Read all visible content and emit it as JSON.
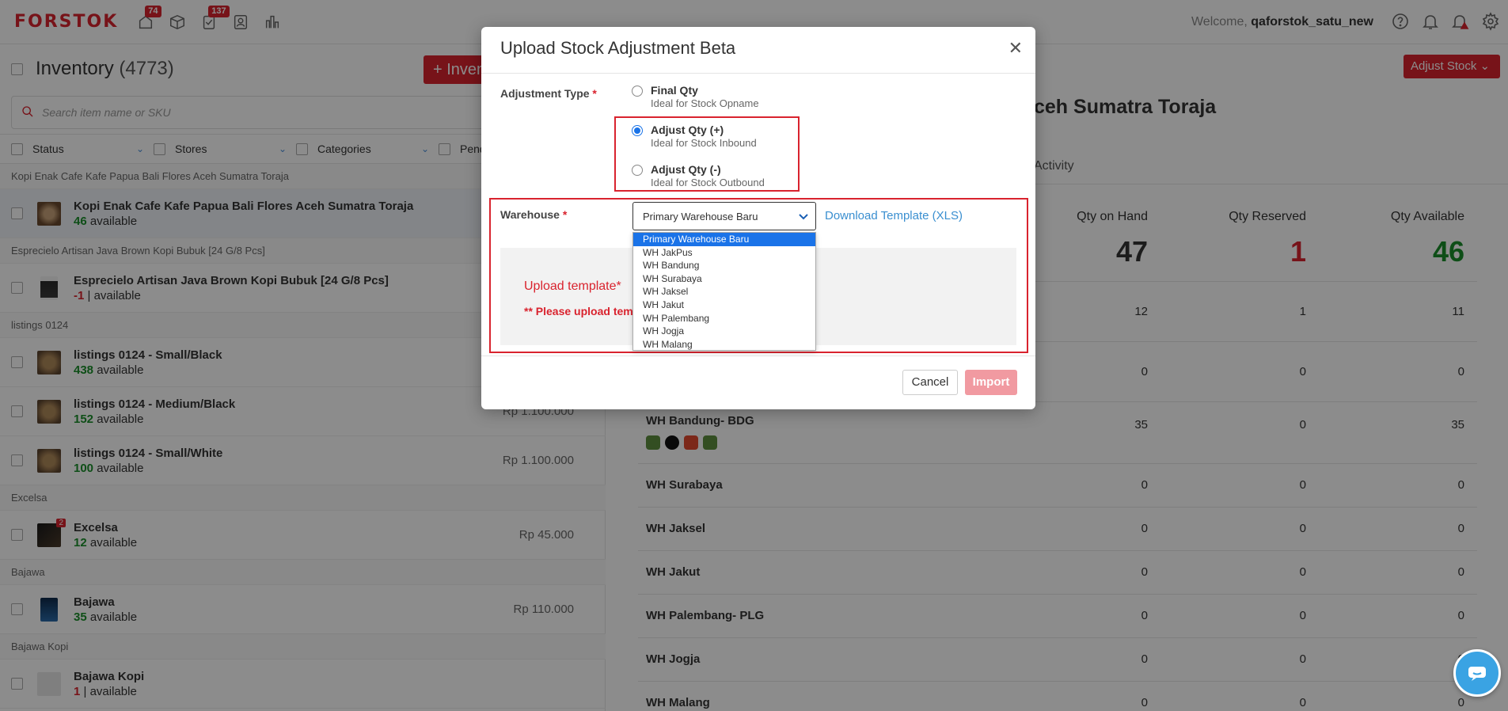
{
  "app": {
    "logo": "FORSTOK",
    "badges": {
      "orders": "74",
      "tasks": "137"
    },
    "welcome_prefix": "Welcome,",
    "username": "qaforstok_satu_new"
  },
  "inventory": {
    "title": "Inventory",
    "count": "(4773)",
    "add_button": "+ Inven",
    "search_placeholder": "Search item name or SKU",
    "filters": [
      "Status",
      "Stores",
      "Categories",
      "Pend"
    ],
    "groups": [
      {
        "name": "Kopi Enak Cafe Kafe Papua Bali Flores Aceh Sumatra Toraja",
        "items": [
          {
            "name": "Kopi Enak Cafe Kafe Papua Bali Flores Aceh Sumatra Toraja",
            "qty": "46",
            "suffix": "available",
            "price": ""
          }
        ]
      },
      {
        "name": "Esprecielo Artisan Java Brown Kopi Bubuk [24 G/8 Pcs]",
        "items": [
          {
            "name": "Esprecielo Artisan Java Brown Kopi Bubuk [24 G/8 Pcs]",
            "qty": "-1",
            "suffix": "| available",
            "price": ""
          }
        ]
      },
      {
        "name": "listings 0124",
        "items": [
          {
            "name": "listings 0124 - Small/Black",
            "qty": "438",
            "suffix": "available",
            "price": ""
          },
          {
            "name": "listings 0124 - Medium/Black",
            "qty": "152",
            "suffix": "available",
            "price": "Rp 1.100.000"
          },
          {
            "name": "listings 0124 - Small/White",
            "qty": "100",
            "suffix": "available",
            "price": "Rp 1.100.000"
          }
        ]
      },
      {
        "name": "Excelsa",
        "items": [
          {
            "name": "Excelsa",
            "qty": "12",
            "suffix": "available",
            "price": "Rp 45.000",
            "badge": "2"
          }
        ]
      },
      {
        "name": "Bajawa",
        "items": [
          {
            "name": "Bajawa",
            "qty": "35",
            "suffix": "available",
            "price": "Rp 110.000"
          }
        ]
      },
      {
        "name": "Bajawa Kopi",
        "items": [
          {
            "name": "Bajawa Kopi",
            "qty": "1",
            "suffix": "| available",
            "price": ""
          }
        ]
      }
    ]
  },
  "detail": {
    "adjust_button": "Adjust Stock",
    "title_partial": "ceh Sumatra Toraja",
    "tab_activity": "Activity",
    "headers": {
      "on_hand": "Qty on Hand",
      "reserved": "Qty Reserved",
      "available": "Qty Available"
    },
    "totals": {
      "on_hand": "47",
      "reserved": "1",
      "available": "46"
    },
    "rows": [
      {
        "name": "",
        "on_hand": "12",
        "reserved": "1",
        "available": "11"
      },
      {
        "name": "",
        "on_hand": "0",
        "reserved": "0",
        "available": "0"
      },
      {
        "name": "WH Bandung- BDG",
        "on_hand": "35",
        "reserved": "0",
        "available": "35",
        "channels": true
      },
      {
        "name": "WH Surabaya",
        "on_hand": "0",
        "reserved": "0",
        "available": "0"
      },
      {
        "name": "WH Jaksel",
        "on_hand": "0",
        "reserved": "0",
        "available": "0"
      },
      {
        "name": "WH Jakut",
        "on_hand": "0",
        "reserved": "0",
        "available": "0"
      },
      {
        "name": "WH Palembang- PLG",
        "on_hand": "0",
        "reserved": "0",
        "available": "0"
      },
      {
        "name": "WH Jogja",
        "on_hand": "0",
        "reserved": "0",
        "available": "0"
      },
      {
        "name": "WH Malang",
        "on_hand": "0",
        "reserved": "0",
        "available": "0"
      }
    ]
  },
  "modal": {
    "title": "Upload Stock Adjustment Beta",
    "adjustment_label": "Adjustment Type",
    "required": "*",
    "options": [
      {
        "title": "Final Qty",
        "sub": "Ideal for Stock Opname",
        "checked": false
      },
      {
        "title": "Adjust Qty (+)",
        "sub": "Ideal for Stock Inbound",
        "checked": true
      },
      {
        "title": "Adjust Qty (-)",
        "sub": "Ideal for Stock Outbound",
        "checked": false
      }
    ],
    "warehouse_label": "Warehouse",
    "warehouse_selected": "Primary Warehouse Baru",
    "download_link": "Download Template (XLS)",
    "upload_label": "Upload template",
    "upload_note": "** Please upload tem",
    "cancel": "Cancel",
    "import": "Import",
    "warehouse_options": [
      "Primary Warehouse Baru",
      "WH JakPus",
      "WH Bandung",
      "WH Surabaya",
      "WH Jaksel",
      "WH Jakut",
      "WH Palembang",
      "WH Jogja",
      "WH Malang"
    ]
  },
  "colors": {
    "brand": "#d9232e",
    "link": "#3a8fd0",
    "green": "#1a8f2a",
    "chat": "#3aa3e3"
  },
  "icons": [
    "orders-icon",
    "box-icon",
    "tasks-icon",
    "contacts-icon",
    "chart-icon",
    "help-icon",
    "bell-icon",
    "alert-bell-icon",
    "gear-icon",
    "search-icon",
    "chevron-down-icon",
    "close-icon",
    "chat-icon"
  ]
}
